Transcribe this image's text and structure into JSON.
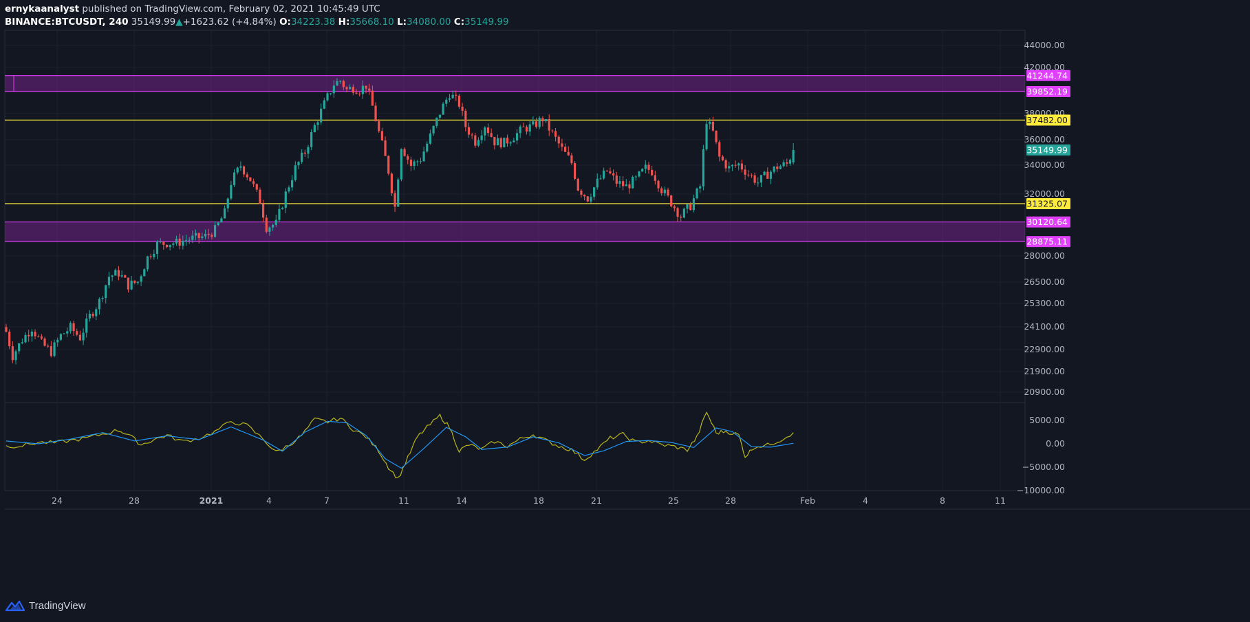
{
  "header": {
    "publisher": "ernykaanalyst",
    "published_text": "published on TradingView.com, February 02, 2021 10:45:49 UTC",
    "symbol": "BINANCE:BTCUSDT, 240",
    "last": "35149.99",
    "change": "+1623.62 (+4.84%)",
    "o_label": "O:",
    "o": "34223.38",
    "h_label": "H:",
    "h": "35668.10",
    "l_label": "L:",
    "l": "34080.00",
    "c_label": "C:",
    "c": "35149.99"
  },
  "footer": {
    "brand": "TradingView"
  },
  "colors": {
    "background": "#131722",
    "up": "#26a69a",
    "down": "#ef5350",
    "zone": "#9c27b0",
    "zone_label": "#e040fb",
    "level_line": "#ffeb3b",
    "indicator_fast": "#b7b41d",
    "indicator_slow": "#2196f3"
  },
  "chart_data": [
    {
      "type": "candlestick",
      "x_ticks": [
        "24",
        "28",
        "2021",
        "4",
        "7",
        "11",
        "14",
        "18",
        "21",
        "25",
        "28",
        "Feb",
        "4",
        "8",
        "11"
      ],
      "y_ticks": [
        "44000.00",
        "42000.00",
        "38000.00",
        "36000.00",
        "34000.00",
        "32000.00",
        "28000.00",
        "26500.00",
        "25300.00",
        "24100.00",
        "22900.00",
        "21900.00",
        "20900.00"
      ],
      "y_scale": "log",
      "ylim": [
        20300,
        46000
      ],
      "last_price_label": "35149.99",
      "zones": [
        {
          "top": 41244.74,
          "bottom": 39852.19,
          "top_label": "41244.74",
          "bottom_label": "39852.19"
        },
        {
          "top": 30120.64,
          "bottom": 28875.11,
          "top_label": "30120.64",
          "bottom_label": "28875.11"
        }
      ],
      "levels": [
        {
          "value": 37482.0,
          "label": "37482.00"
        },
        {
          "value": 31325.07,
          "label": "31325.07"
        }
      ],
      "close_path": [
        [
          0,
          23800
        ],
        [
          2,
          22600
        ],
        [
          5,
          23400
        ],
        [
          8,
          24000
        ],
        [
          11,
          23200
        ],
        [
          14,
          22800
        ],
        [
          17,
          23600
        ],
        [
          20,
          24000
        ],
        [
          23,
          23500
        ],
        [
          26,
          24600
        ],
        [
          29,
          25400
        ],
        [
          32,
          26800
        ],
        [
          35,
          27000
        ],
        [
          38,
          26300
        ],
        [
          41,
          26500
        ],
        [
          44,
          27900
        ],
        [
          47,
          28700
        ],
        [
          50,
          28800
        ],
        [
          53,
          28800
        ],
        [
          56,
          29000
        ],
        [
          59,
          29100
        ],
        [
          62,
          29200
        ],
        [
          65,
          29600
        ],
        [
          68,
          30700
        ],
        [
          70,
          32800
        ],
        [
          73,
          34000
        ],
        [
          76,
          33000
        ],
        [
          79,
          31500
        ],
        [
          81,
          29800
        ],
        [
          84,
          30000
        ],
        [
          87,
          32000
        ],
        [
          90,
          33800
        ],
        [
          93,
          35000
        ],
        [
          96,
          37000
        ],
        [
          99,
          38800
        ],
        [
          102,
          40500
        ],
        [
          104,
          40800
        ],
        [
          106,
          40000
        ],
        [
          108,
          40200
        ],
        [
          110,
          40000
        ],
        [
          112,
          40400
        ],
        [
          114,
          38600
        ],
        [
          116,
          36500
        ],
        [
          119,
          33600
        ],
        [
          121,
          31100
        ],
        [
          123,
          35500
        ],
        [
          126,
          34000
        ],
        [
          129,
          34500
        ],
        [
          132,
          36200
        ],
        [
          135,
          38100
        ],
        [
          138,
          39700
        ],
        [
          141,
          38800
        ],
        [
          143,
          37000
        ],
        [
          146,
          35800
        ],
        [
          149,
          37100
        ],
        [
          152,
          35800
        ],
        [
          155,
          35700
        ],
        [
          158,
          36200
        ],
        [
          161,
          36800
        ],
        [
          164,
          37000
        ],
        [
          167,
          37600
        ],
        [
          170,
          36400
        ],
        [
          173,
          35200
        ],
        [
          176,
          34200
        ],
        [
          178,
          32400
        ],
        [
          181,
          31700
        ],
        [
          184,
          32800
        ],
        [
          187,
          33600
        ],
        [
          190,
          32800
        ],
        [
          193,
          32500
        ],
        [
          196,
          33000
        ],
        [
          199,
          33800
        ],
        [
          201,
          33600
        ],
        [
          204,
          32300
        ],
        [
          207,
          31400
        ],
        [
          210,
          30500
        ],
        [
          213,
          31200
        ],
        [
          216,
          32500
        ],
        [
          218,
          37500
        ],
        [
          220,
          36500
        ],
        [
          222,
          34600
        ],
        [
          225,
          33800
        ],
        [
          228,
          34100
        ],
        [
          231,
          33400
        ],
        [
          234,
          32800
        ],
        [
          237,
          33400
        ],
        [
          240,
          33900
        ],
        [
          243,
          34100
        ],
        [
          245,
          35150
        ]
      ],
      "indicator": {
        "y_ticks": [
          "5000.00",
          "0.00",
          "−5000.00",
          "−10000.00"
        ],
        "ylim": [
          -10000,
          8000
        ],
        "series": [
          {
            "values": [
              [
                0,
                -500
              ],
              [
                5,
                -400
              ],
              [
                10,
                300
              ],
              [
                15,
                200
              ],
              [
                20,
                700
              ],
              [
                25,
                1200
              ],
              [
                30,
                2100
              ],
              [
                35,
                2900
              ],
              [
                38,
                2000
              ],
              [
                42,
                -200
              ],
              [
                46,
                900
              ],
              [
                50,
                1800
              ],
              [
                55,
                500
              ],
              [
                60,
                1200
              ],
              [
                65,
                2600
              ],
              [
                70,
                4800
              ],
              [
                75,
                3900
              ],
              [
                80,
                1000
              ],
              [
                84,
                -1800
              ],
              [
                88,
                -300
              ],
              [
                92,
                1800
              ],
              [
                96,
                5200
              ],
              [
                100,
                4700
              ],
              [
                104,
                5500
              ],
              [
                108,
                3100
              ],
              [
                112,
                1500
              ],
              [
                116,
                -1500
              ],
              [
                119,
                -5000
              ],
              [
                122,
                -7500
              ],
              [
                125,
                -3000
              ],
              [
                128,
                1500
              ],
              [
                131,
                3500
              ],
              [
                135,
                6000
              ],
              [
                138,
                3500
              ],
              [
                141,
                -1500
              ],
              [
                144,
                -200
              ],
              [
                148,
                -1200
              ],
              [
                152,
                500
              ],
              [
                156,
                -500
              ],
              [
                160,
                1000
              ],
              [
                164,
                2000
              ],
              [
                168,
                700
              ],
              [
                172,
                -500
              ],
              [
                176,
                -1300
              ],
              [
                180,
                -3400
              ],
              [
                184,
                -1200
              ],
              [
                188,
                1200
              ],
              [
                192,
                2000
              ],
              [
                196,
                300
              ],
              [
                200,
                700
              ],
              [
                204,
                -200
              ],
              [
                208,
                -600
              ],
              [
                212,
                -1300
              ],
              [
                215,
                1400
              ],
              [
                218,
                6800
              ],
              [
                221,
                2300
              ],
              [
                224,
                2700
              ],
              [
                228,
                1900
              ],
              [
                230,
                -2700
              ],
              [
                233,
                -600
              ],
              [
                237,
                -300
              ],
              [
                241,
                800
              ],
              [
                245,
                2400
              ]
            ]
          },
          {
            "values": [
              [
                0,
                600
              ],
              [
                10,
                0
              ],
              [
                20,
                1000
              ],
              [
                30,
                2400
              ],
              [
                40,
                600
              ],
              [
                50,
                1700
              ],
              [
                60,
                900
              ],
              [
                70,
                3600
              ],
              [
                80,
                800
              ],
              [
                86,
                -1600
              ],
              [
                93,
                2500
              ],
              [
                100,
                4800
              ],
              [
                106,
                4500
              ],
              [
                112,
                1800
              ],
              [
                118,
                -3200
              ],
              [
                123,
                -5200
              ],
              [
                130,
                -1000
              ],
              [
                137,
                3500
              ],
              [
                143,
                1500
              ],
              [
                148,
                -1200
              ],
              [
                156,
                -700
              ],
              [
                164,
                1500
              ],
              [
                172,
                200
              ],
              [
                180,
                -2500
              ],
              [
                186,
                -1500
              ],
              [
                193,
                500
              ],
              [
                200,
                700
              ],
              [
                207,
                300
              ],
              [
                214,
                -800
              ],
              [
                221,
                3400
              ],
              [
                226,
                2600
              ],
              [
                232,
                -600
              ],
              [
                238,
                -700
              ],
              [
                245,
                100
              ]
            ]
          }
        ]
      }
    }
  ]
}
